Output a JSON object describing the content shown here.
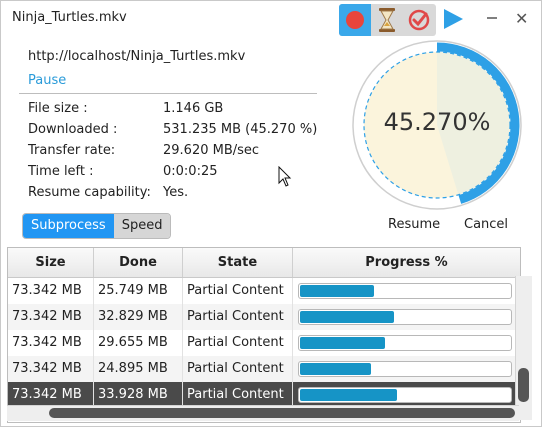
{
  "window": {
    "title": "Ninja_Turtles.mkv"
  },
  "toolbar": {
    "icons": [
      "record-icon",
      "hourglass-icon",
      "check-circle-icon",
      "play-icon",
      "minimize-icon",
      "close-icon"
    ],
    "close_glyph": "✕"
  },
  "download": {
    "url": "http://localhost/Ninja_Turtles.mkv",
    "pause_label": "Pause",
    "fields": [
      {
        "label": "File size :",
        "value": "1.146 GB"
      },
      {
        "label": "Downloaded :",
        "value": "531.235 MB (45.270 %)"
      },
      {
        "label": "Transfer rate:",
        "value": "29.620 MB/sec"
      },
      {
        "label": "Time left :",
        "value": "0:0:0:25"
      },
      {
        "label": "Resume capability:",
        "value": "Yes."
      }
    ]
  },
  "tabs": [
    {
      "label": "Subprocess",
      "active": true
    },
    {
      "label": "Speed",
      "active": false
    }
  ],
  "gauge": {
    "text": "45.270%",
    "progress": 0.4527
  },
  "actions": {
    "resume": "Resume",
    "cancel": "Cancel"
  },
  "table": {
    "columns": [
      "Size",
      "Done",
      "State",
      "Progress %"
    ],
    "rows": [
      {
        "size": "73.342 MB",
        "done": "25.749 MB",
        "state": "Partial Content",
        "progress": 0.351
      },
      {
        "size": "73.342 MB",
        "done": "32.829 MB",
        "state": "Partial Content",
        "progress": 0.448
      },
      {
        "size": "73.342 MB",
        "done": "29.655 MB",
        "state": "Partial Content",
        "progress": 0.404
      },
      {
        "size": "73.342 MB",
        "done": "24.895 MB",
        "state": "Partial Content",
        "progress": 0.339
      },
      {
        "size": "73.342 MB",
        "done": "33.928 MB",
        "state": "Partial Content",
        "progress": 0.463,
        "selected": true
      }
    ]
  },
  "colors": {
    "accent": "#2196f3",
    "progress": "#1694c6",
    "record": "#e8453c",
    "gauge_fill": "#fbf4dc"
  }
}
